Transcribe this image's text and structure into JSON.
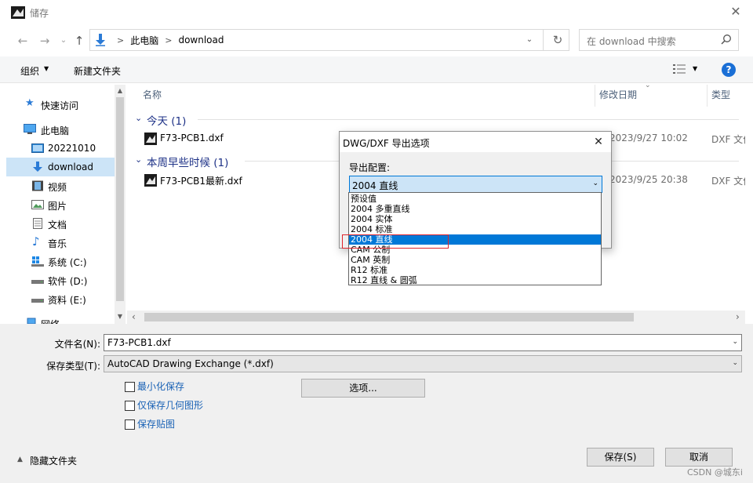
{
  "window": {
    "title": "储存"
  },
  "address": {
    "crumbs": [
      "此电脑",
      "download"
    ]
  },
  "search": {
    "placeholder": "在 download 中搜索"
  },
  "toolbar": {
    "organize": "组织",
    "new_folder": "新建文件夹"
  },
  "nav": {
    "items": [
      {
        "label": "快速访问",
        "icon": "star-icon"
      },
      {
        "label": "此电脑",
        "icon": "computer-icon"
      },
      {
        "label": "20221010",
        "icon": "folder-icon"
      },
      {
        "label": "download",
        "icon": "download-icon"
      },
      {
        "label": "视频",
        "icon": "video-icon"
      },
      {
        "label": "图片",
        "icon": "picture-icon"
      },
      {
        "label": "文档",
        "icon": "document-icon"
      },
      {
        "label": "音乐",
        "icon": "music-icon"
      },
      {
        "label": "系统 (C:)",
        "icon": "windows-drive-icon"
      },
      {
        "label": "软件 (D:)",
        "icon": "drive-icon"
      },
      {
        "label": "资料 (E:)",
        "icon": "drive-icon"
      },
      {
        "label": "网络",
        "icon": "network-icon"
      }
    ]
  },
  "columns": {
    "name": "名称",
    "date": "修改日期",
    "type": "类型"
  },
  "groups": [
    {
      "label": "今天 (1)",
      "files": [
        {
          "name": "F73-PCB1.dxf",
          "date": "2023/9/27 10:02",
          "type": "DXF 文件"
        }
      ]
    },
    {
      "label": "本周早些时候 (1)",
      "files": [
        {
          "name": "F73-PCB1最新.dxf",
          "date": "2023/9/25 20:38",
          "type": "DXF 文件"
        }
      ]
    }
  ],
  "form": {
    "filename_label": "文件名(N):",
    "filename_value": "F73-PCB1.dxf",
    "filetype_label": "保存类型(T):",
    "filetype_value": "AutoCAD Drawing Exchange (*.dxf)",
    "options": [
      "最小化保存",
      "仅保存几何图形",
      "保存贴图"
    ],
    "options_button": "选项...",
    "hide_folders": "隐藏文件夹",
    "save_button": "保存(S)",
    "cancel_button": "取消"
  },
  "dxf_dialog": {
    "title": "DWG/DXF 导出选项",
    "label": "导出配置:",
    "selected": "2004 直线",
    "options": [
      "预设值",
      "2004 多重直线",
      "2004 实体",
      "2004 标准",
      "2004 直线",
      "CAM 公制",
      "CAM 英制",
      "R12 标准",
      "R12 直线 & 圆弧"
    ],
    "selected_index": 4
  },
  "watermark": "CSDN @城东i",
  "colors": {
    "accent": "#0078d7",
    "highlight": "#e0242c",
    "group_header": "#1e3287"
  }
}
